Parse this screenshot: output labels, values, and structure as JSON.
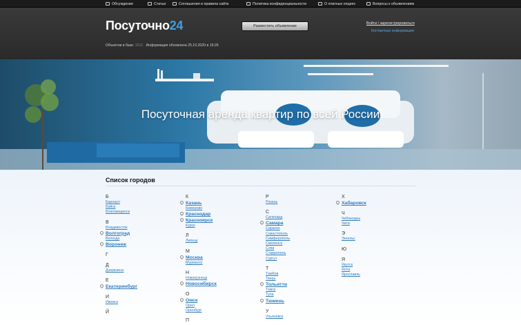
{
  "nav": [
    {
      "label": "Обсуждения",
      "icon": "chat-icon"
    },
    {
      "label": "Статьи",
      "icon": "document-icon"
    },
    {
      "label": "Соглашения и правила сайта",
      "icon": "document-icon"
    },
    {
      "label": "Политика конфиденциальности",
      "icon": "document-icon"
    },
    {
      "label": "О платных опциях",
      "icon": "document-icon"
    },
    {
      "label": "Вопросы к объявлениям",
      "icon": "question-icon"
    }
  ],
  "header": {
    "logo_main": "Посуточно",
    "logo_accent": "24",
    "place_button": "Разместить объявление",
    "login": "Войти / зарегистрироваться",
    "contact": "Контактная информация",
    "stats_label": "Объектов в базе:",
    "stats_count": "1512",
    "stats_updated": "Информация обновлена 25.10.2020 в 16:26"
  },
  "hero": {
    "title": "Посуточная аренда квартир по всей России"
  },
  "cities": {
    "title": "Список городов",
    "columns": [
      [
        {
          "letter": "Б",
          "items": [
            {
              "name": "Барнаул"
            },
            {
              "name": "Бийск"
            },
            {
              "name": "Благовещенск"
            }
          ]
        },
        {
          "letter": "В",
          "items": [
            {
              "name": "Владивосток"
            },
            {
              "name": "Волгоград",
              "big": true
            },
            {
              "name": "Вологда"
            },
            {
              "name": "Воронеж",
              "big": true
            }
          ]
        },
        {
          "letter": "Г",
          "items": []
        },
        {
          "letter": "Д",
          "items": [
            {
              "name": "Дзержинск"
            }
          ]
        },
        {
          "letter": "Е",
          "items": [
            {
              "name": "Екатеринбург",
              "big": true
            }
          ]
        },
        {
          "letter": "И",
          "items": [
            {
              "name": "Ижевск"
            }
          ]
        },
        {
          "letter": "Й",
          "items": []
        }
      ],
      [
        {
          "letter": "К",
          "items": [
            {
              "name": "Казань",
              "big": true
            },
            {
              "name": "Кемерово"
            },
            {
              "name": "Краснодар",
              "big": true
            },
            {
              "name": "Красноярск",
              "big": true
            },
            {
              "name": "Курск"
            }
          ]
        },
        {
          "letter": "Л",
          "items": [
            {
              "name": "Липецк"
            }
          ]
        },
        {
          "letter": "М",
          "items": [
            {
              "name": "Москва",
              "big": true
            },
            {
              "name": "Мурманск"
            }
          ]
        },
        {
          "letter": "Н",
          "items": [
            {
              "name": "Новокузнецк"
            },
            {
              "name": "Новосибирск",
              "big": true
            }
          ]
        },
        {
          "letter": "О",
          "items": [
            {
              "name": "Омск",
              "big": true
            },
            {
              "name": "Орел"
            },
            {
              "name": "Оренбург"
            }
          ]
        },
        {
          "letter": "П",
          "items": []
        }
      ],
      [
        {
          "letter": "Р",
          "items": [
            {
              "name": "Рязань"
            }
          ]
        },
        {
          "letter": "С",
          "items": [
            {
              "name": "Салехард"
            },
            {
              "name": "Самара",
              "big": true
            },
            {
              "name": "Саранск"
            },
            {
              "name": "Севастополь"
            },
            {
              "name": "Симферополь"
            },
            {
              "name": "Смоленск"
            },
            {
              "name": "Сочи"
            },
            {
              "name": "Ставрополь"
            },
            {
              "name": "Сургут"
            }
          ]
        },
        {
          "letter": "Т",
          "items": [
            {
              "name": "Тамбов"
            },
            {
              "name": "Тверь"
            },
            {
              "name": "Тольятти",
              "big": true
            },
            {
              "name": "Томск"
            },
            {
              "name": "Тула"
            },
            {
              "name": "Тюмень",
              "big": true
            }
          ]
        },
        {
          "letter": "У",
          "items": [
            {
              "name": "Ульяновск"
            }
          ]
        }
      ],
      [
        {
          "letter": "Х",
          "items": [
            {
              "name": "Хабаровск",
              "big": true
            }
          ]
        },
        {
          "letter": "Ч",
          "items": [
            {
              "name": "Чебоксары"
            },
            {
              "name": "Чита"
            }
          ]
        },
        {
          "letter": "Э",
          "items": [
            {
              "name": "Энгельс"
            }
          ]
        },
        {
          "letter": "Ю",
          "items": []
        },
        {
          "letter": "Я",
          "items": [
            {
              "name": "Якутск"
            },
            {
              "name": "Ялта"
            },
            {
              "name": "Ярославль"
            }
          ]
        }
      ]
    ]
  }
}
